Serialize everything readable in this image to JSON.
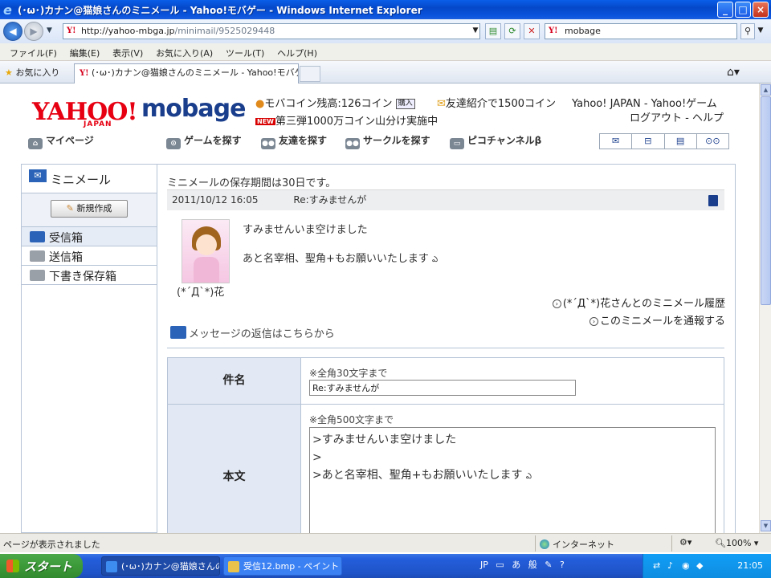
{
  "window": {
    "title": "(･ω･)カナン@猫娘さんのミニメール - Yahoo!モバゲー - Windows Internet Explorer",
    "btn_minimize": "_",
    "btn_maximize": "□",
    "btn_close": "×"
  },
  "addressbar": {
    "url_host": "http://yahoo-mbga.jp",
    "url_path": "/minimail/9525029448",
    "search_value": "mobage"
  },
  "menubar": {
    "items": [
      "ファイル(F)",
      "編集(E)",
      "表示(V)",
      "お気に入り(A)",
      "ツール(T)",
      "ヘルプ(H)"
    ]
  },
  "favbar": {
    "favorites_label": "お気に入り",
    "tab_title": "(･ω･)カナン@猫娘さんのミニメール - Yahoo!モバゲー"
  },
  "header": {
    "logo_yahoo": "YAHOO!",
    "logo_japan": "JAPAN",
    "logo_mobage": "mobage",
    "coin_balance": "モバコイン残高:126コイン",
    "coin_buy": "購入",
    "referral": "友達紹介で1500コイン",
    "yahoo_links": "Yahoo! JAPAN - Yahoo!ゲーム",
    "new_badge": "NEW",
    "campaign": "第三弾1000万コイン山分け実施中",
    "account_links": "ログアウト - ヘルプ"
  },
  "globalnav": {
    "mypage": "マイページ",
    "find_games": "ゲームを探す",
    "find_friends": "友達を探す",
    "find_circles": "サークルを探す",
    "pico_channel": "ピコチャンネルβ"
  },
  "sidebar": {
    "title": "ミニメール",
    "compose": "新規作成",
    "items": [
      {
        "label": "受信箱"
      },
      {
        "label": "送信箱"
      },
      {
        "label": "下書き保存箱"
      }
    ]
  },
  "message": {
    "retention_notice": "ミニメールの保存期間は30日です。",
    "date": "2011/10/12 16:05",
    "subject": "Re:すみませんが",
    "sender_name": "(*´Д`*)花",
    "body_line1": "すみませんいま空けました",
    "body_line2": "あと名宰相、聖角+もお願いいたします",
    "history_link": "(*´Д`*)花さんとのミニメール履歴",
    "report_link": "このミニメールを通報する"
  },
  "reply": {
    "header": "メッセージの返信はこちらから",
    "subject_label": "件名",
    "subject_hint": "※全角30文字まで",
    "subject_value": "Re:すみませんが",
    "body_label": "本文",
    "body_hint": "※全角500文字まで",
    "body_lines": [
      ">すみませんいま空けました",
      ">",
      ">あと名宰相、聖角+もお願いいたします"
    ]
  },
  "statusbar": {
    "status_text": "ページが表示されました",
    "zone": "インターネット",
    "zoom": "100%"
  },
  "taskbar": {
    "start": "スタート",
    "items": [
      {
        "label": "(･ω･)カナン@猫娘さんの..."
      },
      {
        "label": "受信12.bmp - ペイント"
      }
    ],
    "ime_lang": "JP",
    "ime_mode": "般",
    "clock": "21:05"
  },
  "colors": {
    "titlebar": "#0548c9",
    "yahoo_red": "#e60012",
    "mobage_blue": "#1a3e8c",
    "sidebar_border": "#b5c3d6",
    "form_label_bg": "#e3e9f4"
  }
}
